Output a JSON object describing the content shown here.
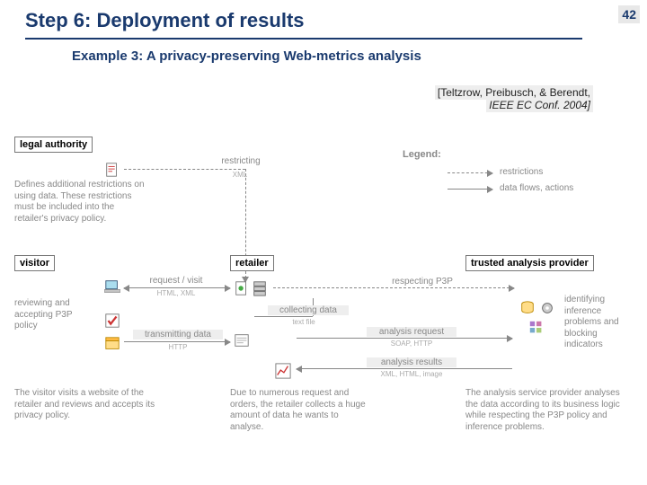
{
  "page_number": "42",
  "title": "Step 6: Deployment of results",
  "subtitle": "Example 3: A privacy-preserving Web-metrics analysis",
  "citation": {
    "authors": "[Teltzrow, Preibusch, & Berendt,",
    "venue": "IEEE EC Conf. 2004]"
  },
  "legend": {
    "head": "Legend:",
    "restrictions": "restrictions",
    "flows": "data flows, actions"
  },
  "actors": {
    "legal": {
      "label": "legal authority",
      "desc": "Defines additional restrictions on using data. These restrictions must be included into the retailer's privacy policy."
    },
    "visitor": {
      "label": "visitor",
      "desc": "The visitor visits a website of the retailer and reviews and accepts its privacy policy."
    },
    "retailer": {
      "label": "retailer",
      "desc": "Due to numerous request and orders, the retailer collects a huge amount of data he wants to analyse."
    },
    "provider": {
      "label": "trusted analysis provider",
      "desc": "The analysis service provider analyses the data according to its business logic while respecting the P3P policy and inference problems."
    }
  },
  "flows": {
    "restricting": "restricting",
    "restricting_sub": "XML",
    "request": "request / visit",
    "request_sub": "HTML, XML",
    "review": "reviewing and accepting P3P policy",
    "transmit": "transmitting data",
    "transmit_sub": "HTTP",
    "collect": "collecting data",
    "collect_sub": "text file",
    "respect": "respecting P3P",
    "analysis_req": "analysis request",
    "analysis_req_sub": "SOAP, HTTP",
    "analysis_res": "analysis results",
    "analysis_res_sub": "XML, HTML, image",
    "identify": "identifying inference problems and blocking indicators"
  }
}
